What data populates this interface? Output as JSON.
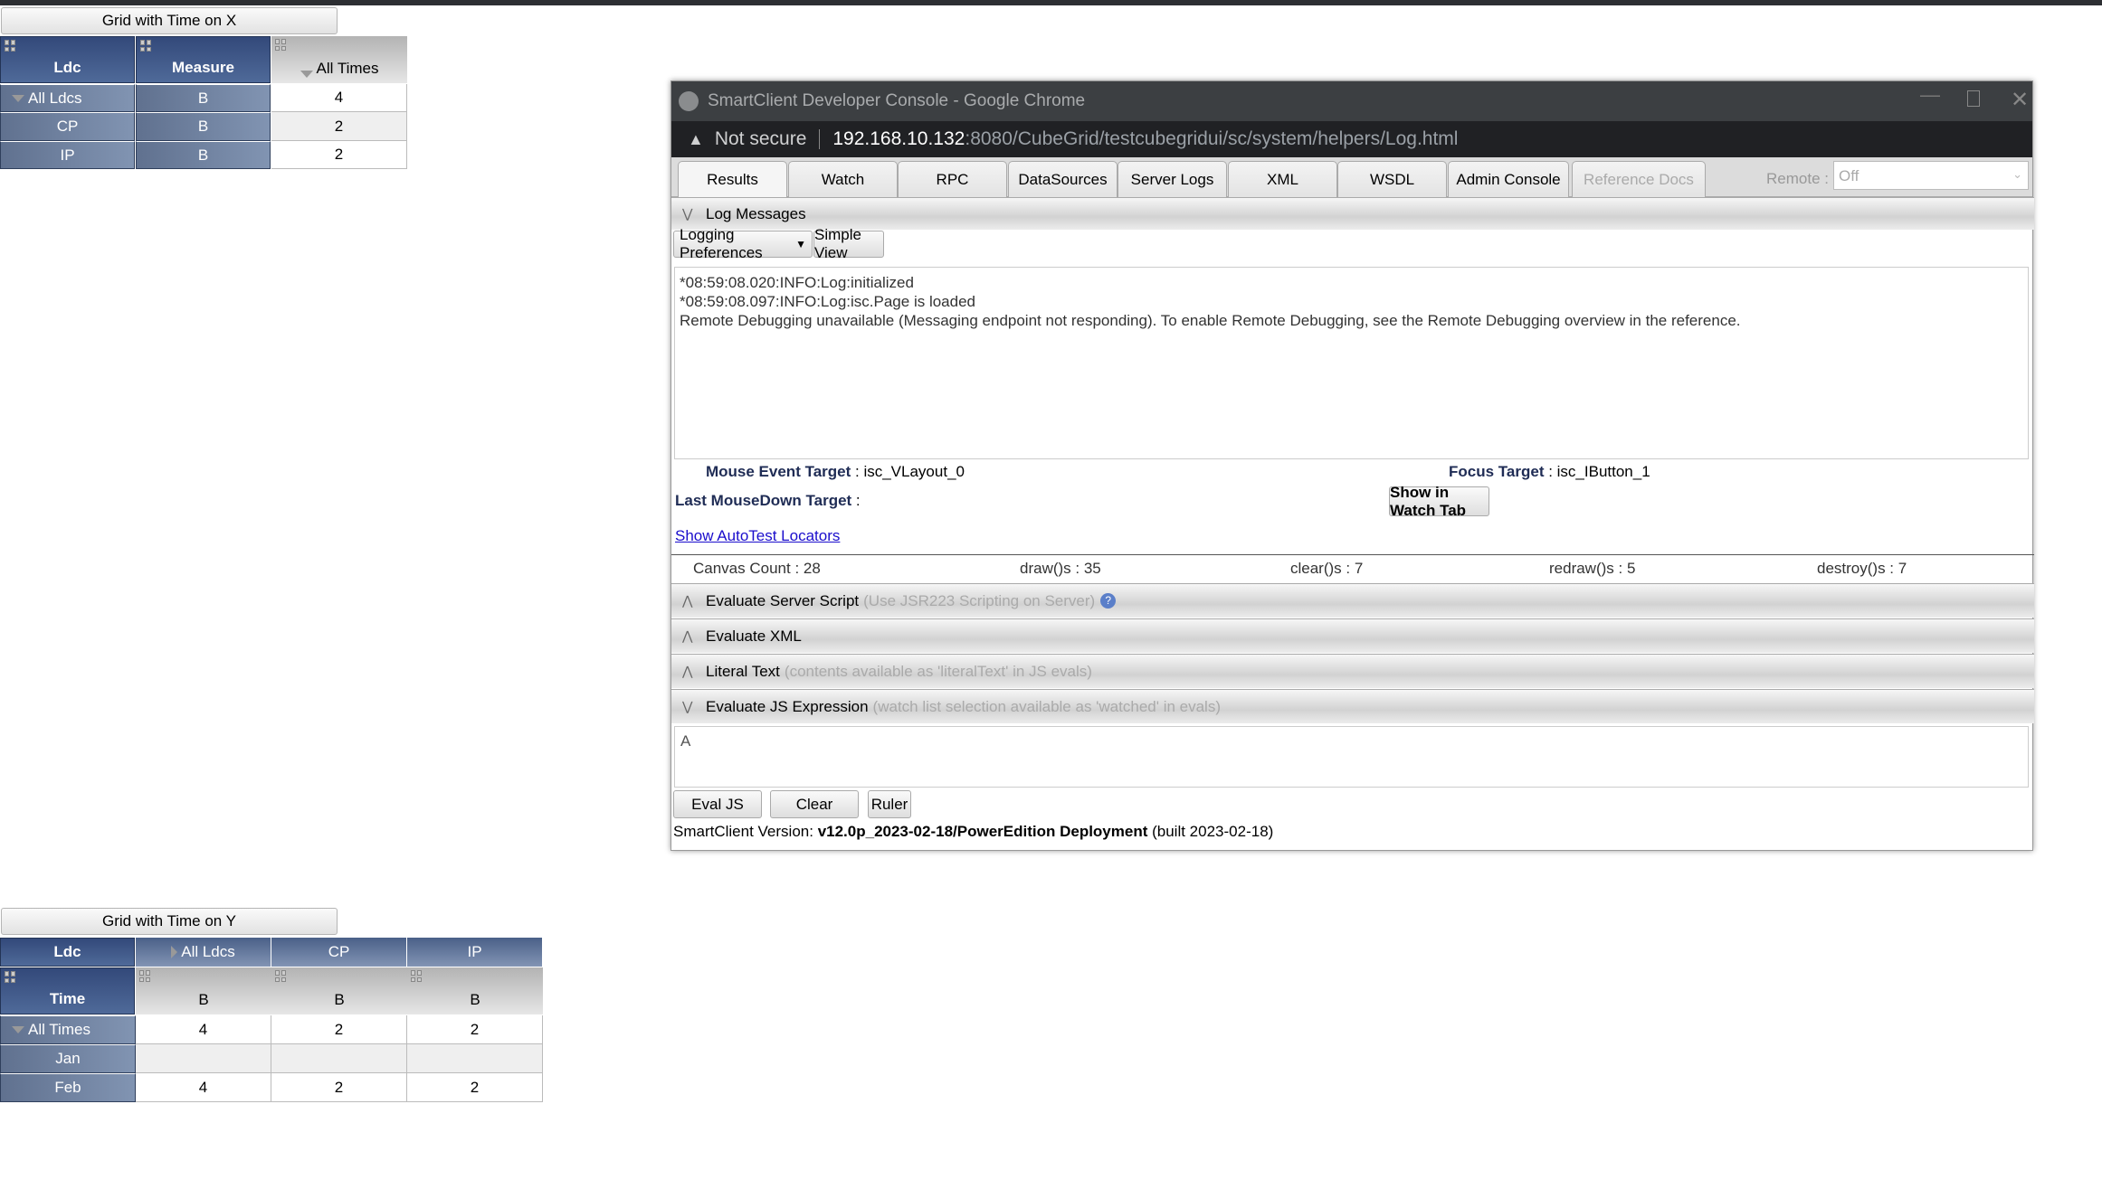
{
  "grid_x": {
    "button": "Grid with Time on X",
    "headers": [
      "Ldc",
      "Measure",
      "All Times"
    ],
    "rows": [
      {
        "ldc": "All Ldcs",
        "measure": "B",
        "value": "4",
        "expanded": true
      },
      {
        "ldc": "CP",
        "measure": "B",
        "value": "2"
      },
      {
        "ldc": "IP",
        "measure": "B",
        "value": "2"
      }
    ]
  },
  "grid_y": {
    "button": "Grid with Time on Y",
    "corner_top": "Ldc",
    "corner_bottom": "Time",
    "columns": [
      "All Ldcs",
      "CP",
      "IP"
    ],
    "measures": [
      "B",
      "B",
      "B"
    ],
    "rows": [
      {
        "time": "All Times",
        "values": [
          "4",
          "2",
          "2"
        ],
        "expanded": true
      },
      {
        "time": "Jan",
        "values": [
          "",
          "",
          ""
        ]
      },
      {
        "time": "Feb",
        "values": [
          "4",
          "2",
          "2"
        ]
      }
    ]
  },
  "console": {
    "window_title": "SmartClient Developer Console - Google Chrome",
    "security": "Not secure",
    "url_host": "192.168.10.132",
    "url_rest": ":8080/CubeGrid/testcubegridui/sc/system/helpers/Log.html",
    "tabs": [
      "Results",
      "Watch",
      "RPC",
      "DataSources",
      "Server Logs",
      "XML",
      "WSDL",
      "Admin Console",
      "Reference Docs"
    ],
    "remote_label": "Remote :",
    "remote_value": "Off",
    "log_section": "Log Messages",
    "logging_prefs": "Logging Preferences",
    "simple_view": "Simple View",
    "log_lines": [
      "*08:59:08.020:INFO:Log:initialized",
      "*08:59:08.097:INFO:Log:isc.Page is loaded",
      "Remote Debugging unavailable (Messaging endpoint not responding).  To enable Remote Debugging, see the Remote Debugging overview in the reference."
    ],
    "mouse_event_label": "Mouse Event Target",
    "mouse_event_value": "isc_VLayout_0",
    "focus_label": "Focus Target",
    "focus_value": "isc_IButton_1",
    "last_mousedown_label": "Last MouseDown Target",
    "show_watch": "Show in Watch Tab",
    "autotest_link": "Show AutoTest Locators",
    "stats": [
      "Canvas Count : 28",
      "draw()s : 35",
      "clear()s : 7",
      "redraw()s : 5",
      "destroy()s : 7"
    ],
    "sections": [
      {
        "title": "Evaluate Server Script",
        "hint": "(Use JSR223 Scripting on Server)"
      },
      {
        "title": "Evaluate XML",
        "hint": ""
      },
      {
        "title": "Literal Text",
        "hint": "(contents available as 'literalText' in JS evals)"
      },
      {
        "title": "Evaluate JS Expression",
        "hint": "(watch list selection available as 'watched' in evals)"
      }
    ],
    "js_input": "A",
    "eval_js": "Eval JS",
    "clear": "Clear",
    "ruler": "Ruler",
    "version_label": "SmartClient Version: ",
    "version_value": "v12.0p_2023-02-18/PowerEdition Deployment",
    "version_built": " (built 2023-02-18)"
  }
}
